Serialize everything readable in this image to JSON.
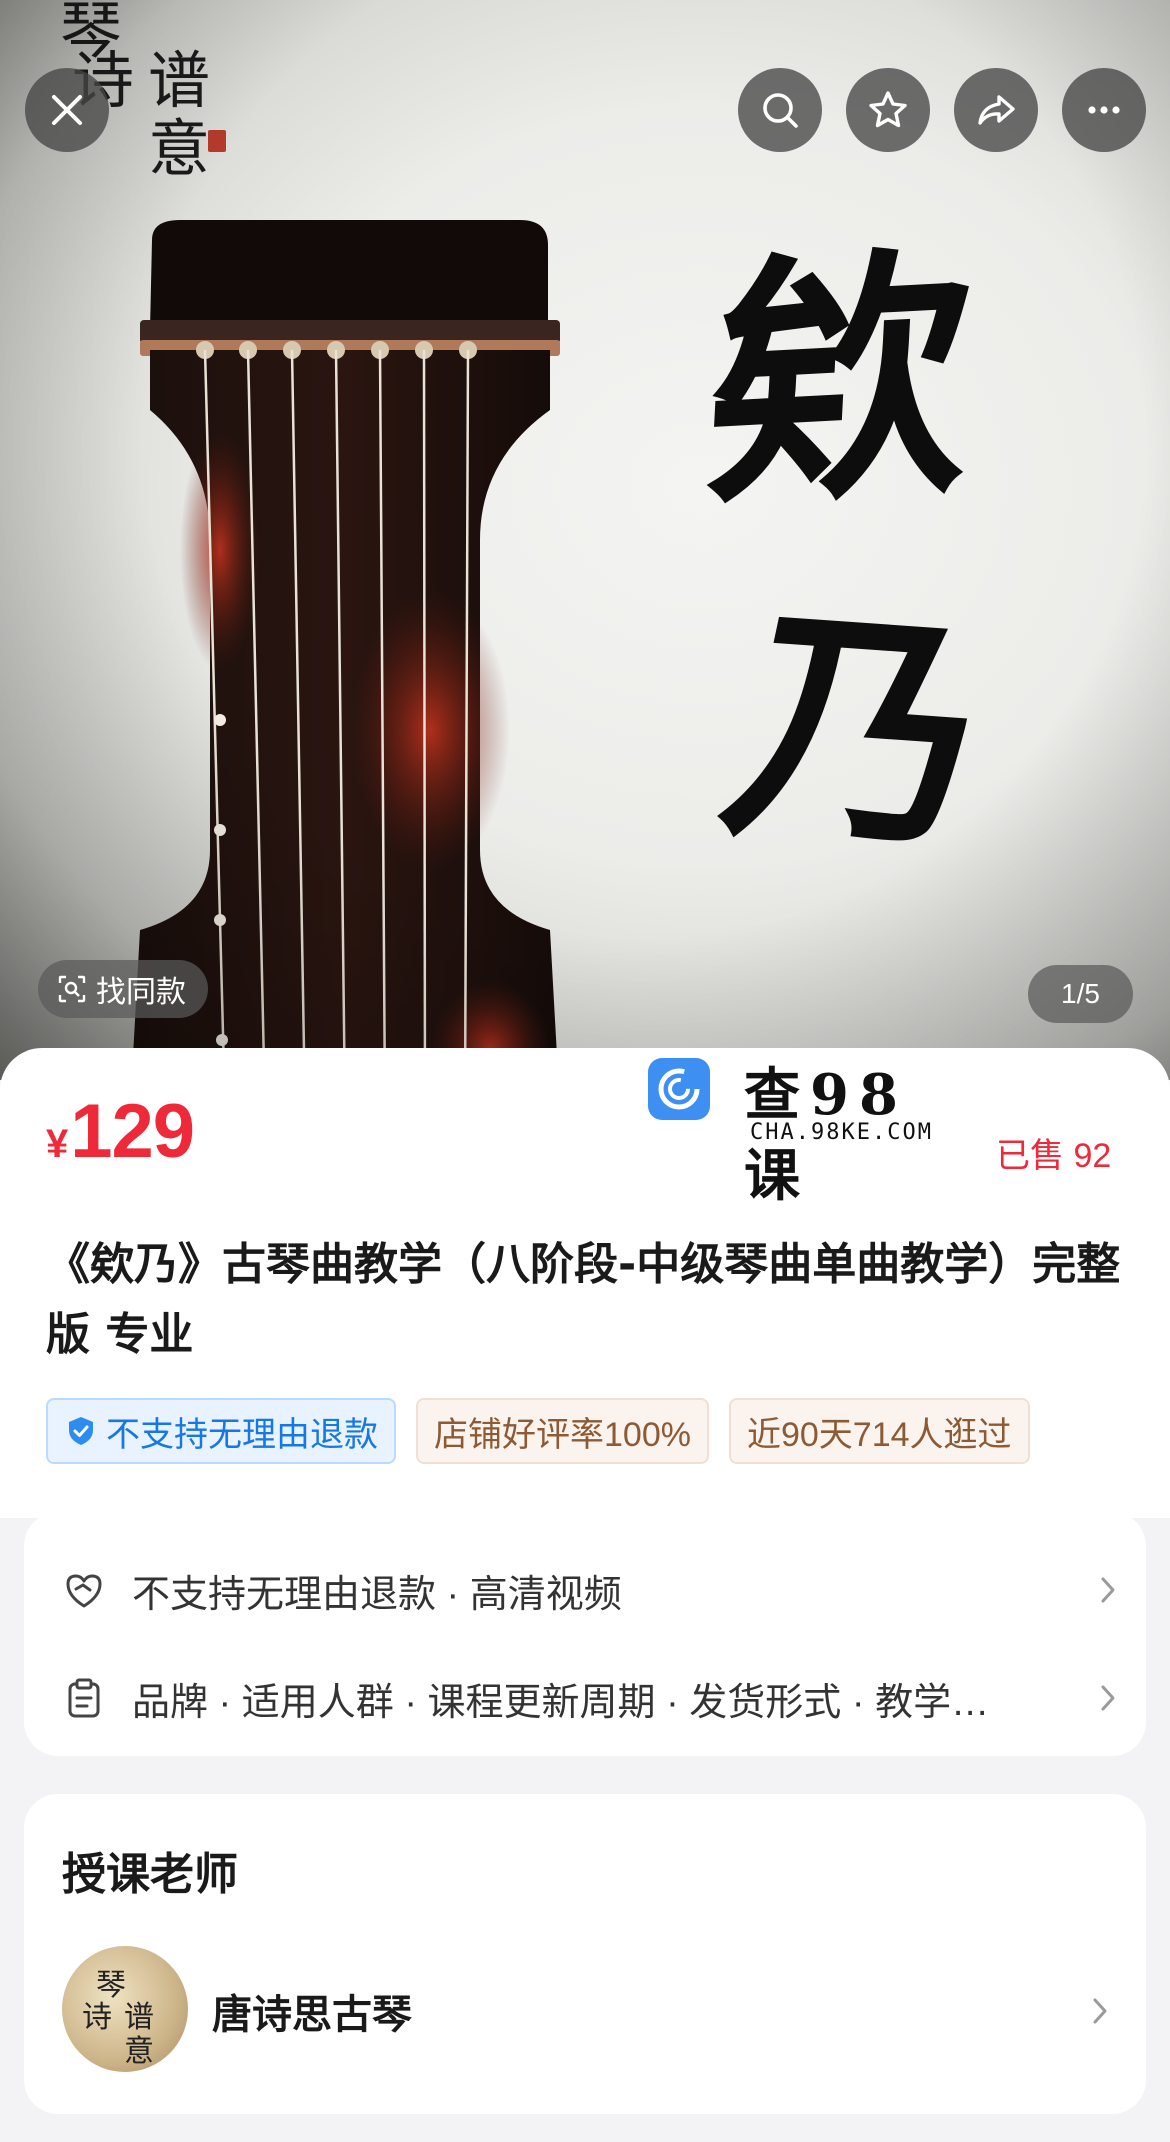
{
  "hero": {
    "logo_chars": [
      "琴",
      "诗",
      "谱",
      "意"
    ],
    "calligraphy": [
      "欸",
      "乃"
    ],
    "find_same_label": "找同款",
    "pager": "1/5"
  },
  "top_actions": [
    "close-icon",
    "search-icon",
    "star-icon",
    "share-icon",
    "more-icon"
  ],
  "product": {
    "currency": "¥",
    "price": "129",
    "sold": "已售 92",
    "title": "《欸乃》古琴曲教学（八阶段-中级琴曲单曲教学）完整版 专业",
    "tags": [
      {
        "label": "不支持无理由退款",
        "style": "blue",
        "icon": "shield-check-icon"
      },
      {
        "label": "店铺好评率100%",
        "style": "brown"
      },
      {
        "label": "近90天714人逛过",
        "style": "brown"
      }
    ]
  },
  "watermark": {
    "title": "查98课",
    "subtitle": "CHA.98KE.COM"
  },
  "service": {
    "rows": [
      {
        "icon": "heart-shield-icon",
        "text": "不支持无理由退款 · 高清视频"
      },
      {
        "icon": "clipboard-icon",
        "text": "品牌 · 适用人群 · 课程更新周期 · 发货形式 · 教学…"
      }
    ]
  },
  "teacher": {
    "section_title": "授课老师",
    "name": "唐诗思古琴",
    "avatar_chars": [
      "琴",
      "诗",
      "谱",
      "意"
    ]
  },
  "colors": {
    "price_red": "#ee2a3a",
    "tag_blue": "#1677e6",
    "tag_brown": "#8c5a34",
    "page_bg": "#f3f3f5"
  }
}
